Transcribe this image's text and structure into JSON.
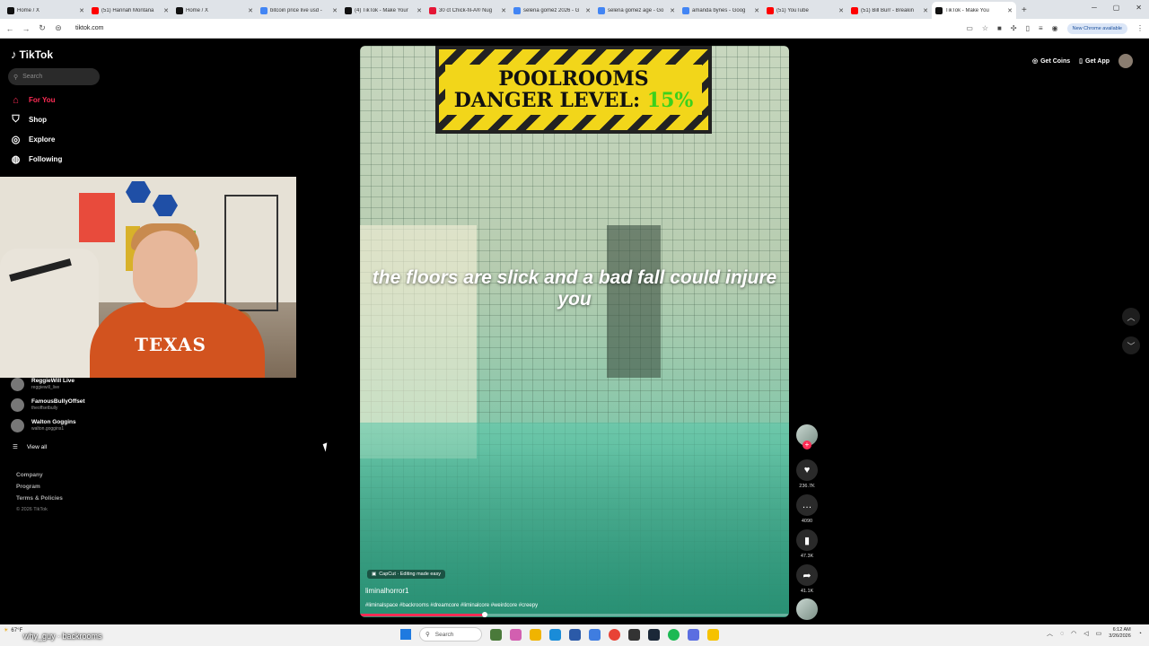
{
  "browser": {
    "tabs": [
      {
        "title": "Home / X",
        "color": "#111111"
      },
      {
        "title": "(51) Hannah Montana",
        "color": "#ff0000"
      },
      {
        "title": "Home / X",
        "color": "#111111"
      },
      {
        "title": "bitcoin price live usd -",
        "color": "#4285f4"
      },
      {
        "title": "(4) TikTok - Make Your",
        "color": "#111111"
      },
      {
        "title": "30 ct Chick-fil-A® Nug",
        "color": "#e51636"
      },
      {
        "title": "selena gomez 2026 - G",
        "color": "#4285f4"
      },
      {
        "title": "selena gomez age - Go",
        "color": "#4285f4"
      },
      {
        "title": "amanda bynes - Goog",
        "color": "#4285f4"
      },
      {
        "title": "(51) YouTube",
        "color": "#ff0000"
      },
      {
        "title": "(51) Bill Burr - Breakin",
        "color": "#ff0000"
      },
      {
        "title": "TikTok - Make You",
        "color": "#111111"
      }
    ],
    "url": "tiktok.com",
    "update_label": "New Chrome available"
  },
  "tiktok": {
    "logo": "TikTok",
    "search_placeholder": "Search",
    "nav": [
      {
        "label": "For You",
        "icon": "home-icon"
      },
      {
        "label": "Shop",
        "icon": "bag-icon"
      },
      {
        "label": "Explore",
        "icon": "compass-icon"
      },
      {
        "label": "Following",
        "icon": "following-icon"
      }
    ],
    "following_accounts": [
      {
        "name": "ReggieWill Live",
        "handle": "reggiewill_live"
      },
      {
        "name": "FamousBullyOffset",
        "handle": "theoffsetbully"
      },
      {
        "name": "Walton Goggins",
        "handle": "walton.goggins1"
      }
    ],
    "view_all": "View all",
    "footer": {
      "company": "Company",
      "program": "Program",
      "terms": "Terms & Policies",
      "copyright": "© 2026 TikTok"
    },
    "top_right": {
      "coins": "Get Coins",
      "app": "Get App"
    }
  },
  "video": {
    "banner_line1": "POOLROOMS",
    "banner_line2": "DANGER LEVEL:",
    "banner_pct": "15%",
    "caption": "the floors are slick and a bad fall could injure you",
    "capcut": "CapCut · Editing made easy",
    "author": "liminalhorror1",
    "hashtags": "#liminalspace #backrooms #dreamcore #liminalcore #weirdcore #creepy",
    "progress_fraction": 0.29,
    "likes": "236.7K",
    "comments": "4090",
    "saves": "47.3K",
    "shares": "41.1K"
  },
  "webcam": {
    "shirt_text": "TEXAS"
  },
  "taskbar": {
    "stream_overlay": "why_guy · backrooms",
    "weather_text": "67°F",
    "search_label": "Search",
    "time": "6:12 AM",
    "date": "3/26/2026"
  }
}
